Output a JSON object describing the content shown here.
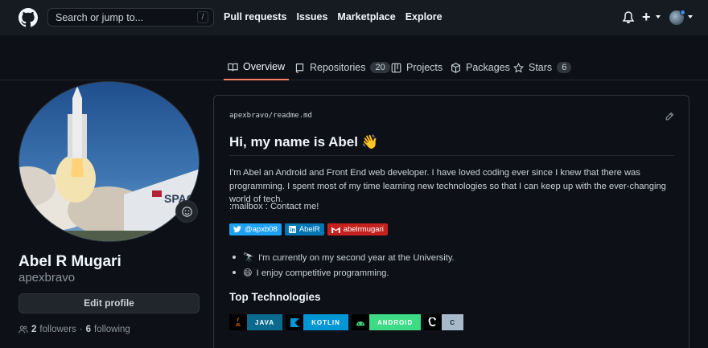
{
  "header": {
    "search_placeholder": "Search or jump to...",
    "search_shortcut": "/",
    "nav": [
      "Pull requests",
      "Issues",
      "Marketplace",
      "Explore"
    ],
    "plus_label": "+"
  },
  "tabs": [
    {
      "label": "Overview",
      "icon": "book-icon",
      "active": true
    },
    {
      "label": "Repositories",
      "icon": "repo-icon",
      "count": "20"
    },
    {
      "label": "Projects",
      "icon": "project-icon"
    },
    {
      "label": "Packages",
      "icon": "package-icon"
    },
    {
      "label": "Stars",
      "icon": "star-icon",
      "count": "6"
    }
  ],
  "profile": {
    "fullname": "Abel R Mugari",
    "username": "apexbravo",
    "edit_label": "Edit profile",
    "followers_count": "2",
    "followers_label": "followers",
    "separator": "·",
    "following_count": "6",
    "following_label": "following"
  },
  "readme": {
    "crumb_owner": "apexbravo",
    "crumb_sep": "/",
    "crumb_file": "readme.md",
    "heading": "Hi, my name is Abel",
    "heading_emoji": "👋",
    "intro": "I'm Abel an Android and Front End web developer. I have loved coding ever since I knew that there was programming. I spent most of my time learning new technologies so that I can keep up with the ever-changing world of tech.",
    "contact": ":mailbox : Contact me!",
    "badges": [
      {
        "label": "@apxb08",
        "color": "#1da1f2",
        "icon": "twitter-icon"
      },
      {
        "label": "AbelR",
        "color": "#0077b5",
        "icon": "linkedin-icon"
      },
      {
        "label": "abelrmugari",
        "color": "#c5221f",
        "icon": "gmail-icon"
      }
    ],
    "bullets": [
      {
        "emoji": "🔭",
        "text": "I'm currently on my second year at the University."
      },
      {
        "emoji": "😄",
        "text": "I enjoy competitive programming."
      }
    ],
    "tech_heading": "Top Technologies",
    "tech": [
      {
        "label": "JAVA",
        "color": "#0a6b8f",
        "icon_bg": "#000000"
      },
      {
        "label": "KOTLIN",
        "color": "#0095d5",
        "icon_bg": "#000000"
      },
      {
        "label": "ANDROID",
        "color": "#3ddc84",
        "icon_bg": "#000000"
      },
      {
        "label": "C",
        "color": "#a8b9cc",
        "icon_bg": "#000000"
      }
    ]
  }
}
